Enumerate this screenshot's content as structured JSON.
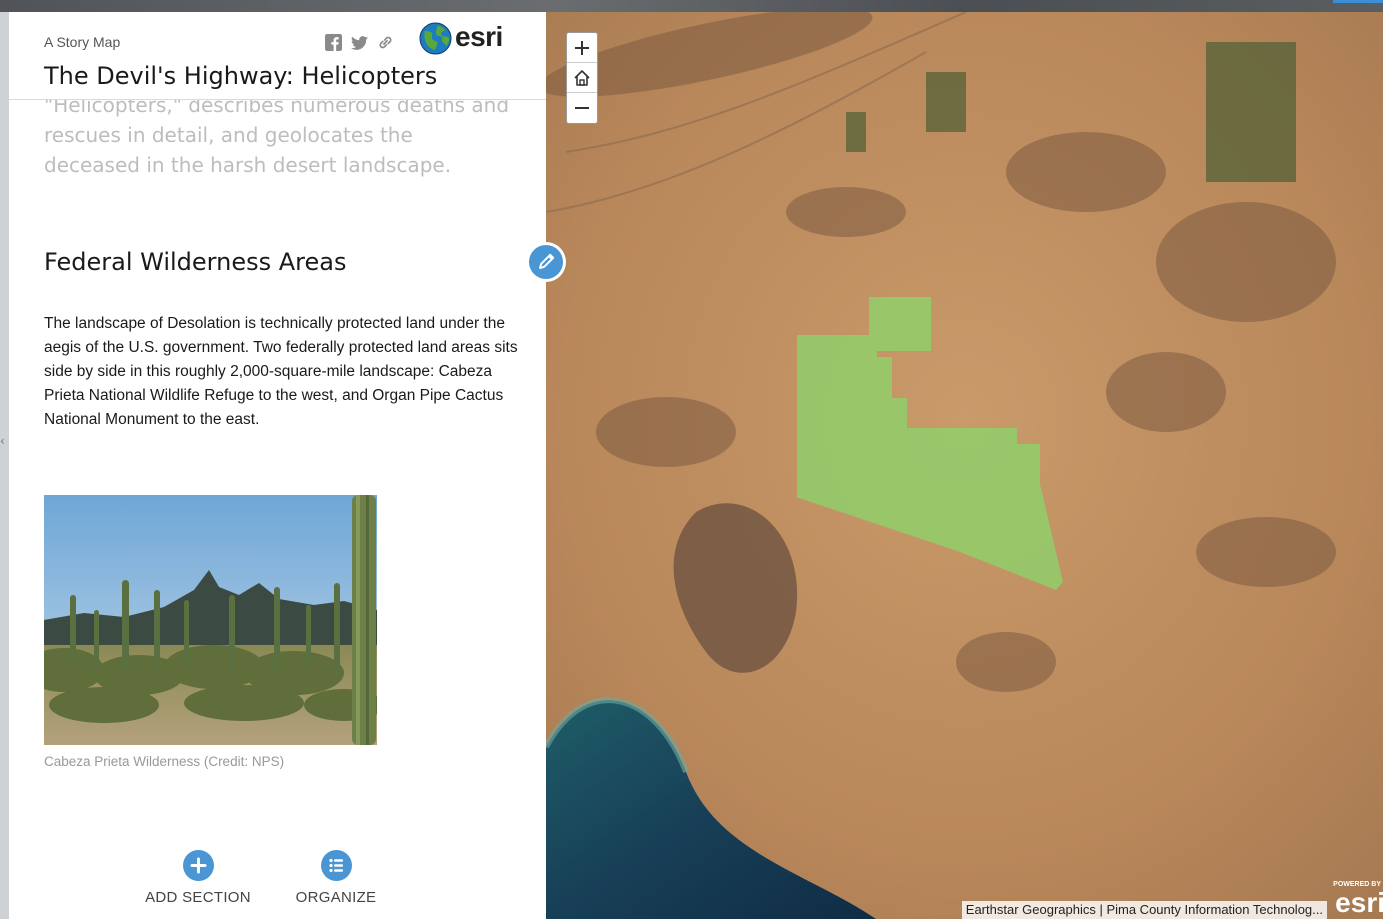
{
  "header": {
    "subtitle": "A Story Map",
    "title": "The Devil's Highway: Helicopters",
    "logo_text": "esri",
    "share_icons": [
      "facebook-icon",
      "twitter-icon",
      "link-icon"
    ]
  },
  "content": {
    "faded_intro": "\"Helicopters,\" describes numerous deaths and rescues in detail, and geolocates the deceased in the harsh desert landscape.",
    "section_title": "Federal Wilderness Areas",
    "section_body": "The landscape of Desolation is technically protected land under the aegis of the U.S. government. Two federally protected land areas sits side by side in this roughly 2,000-square-mile landscape: Cabeza Prieta National Wildlife Refuge to the west, and Organ Pipe Cactus National Monument to the east.",
    "image_caption": "Cabeza Prieta Wilderness (Credit: NPS)"
  },
  "builder": {
    "add_section_label": "ADD SECTION",
    "organize_label": "ORGANIZE"
  },
  "map": {
    "zoom_in_icon": "plus-icon",
    "home_icon": "home-icon",
    "zoom_out_icon": "minus-icon",
    "attribution": "Earthstar Geographics | Pima County Information Technolog...",
    "powered_by_small": "POWERED BY",
    "powered_by_logo": "esri",
    "highlight_color": "#8fd16a"
  },
  "colors": {
    "accent": "#4a95d3"
  }
}
